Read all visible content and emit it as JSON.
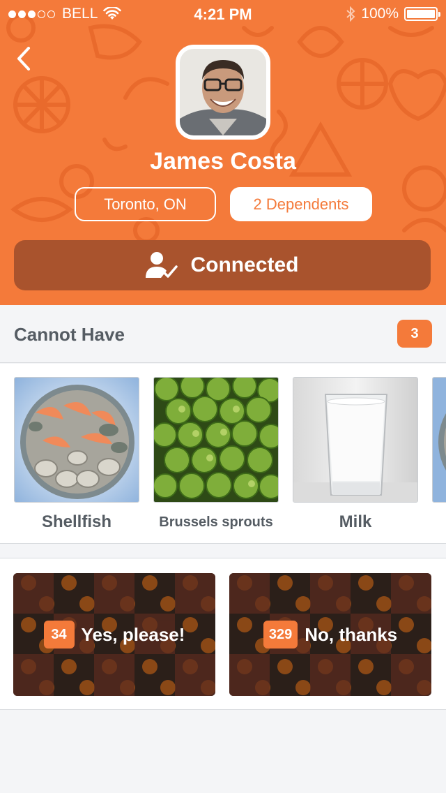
{
  "status_bar": {
    "carrier": "BELL",
    "time": "4:21 PM",
    "battery": "100%",
    "signal_bars_filled": 3,
    "signal_bars_total": 5
  },
  "profile": {
    "name": "James Costa",
    "location": "Toronto, ON",
    "dependents": "2 Dependents",
    "connect_label": "Connected"
  },
  "cannot_have": {
    "title": "Cannot Have",
    "count": "3",
    "items": [
      {
        "label": "Shellfish",
        "icon": "shellfish-image"
      },
      {
        "label": "Brussels sprouts",
        "icon": "brussels-sprouts-image"
      },
      {
        "label": "Milk",
        "icon": "milk-image"
      }
    ]
  },
  "reactions": {
    "yes": {
      "count": "34",
      "label": "Yes, please!"
    },
    "no": {
      "count": "329",
      "label": "No, thanks"
    }
  },
  "colors": {
    "accent": "#f47a3a",
    "connected_bg": "#a9532d",
    "page_bg": "#f4f5f7"
  }
}
